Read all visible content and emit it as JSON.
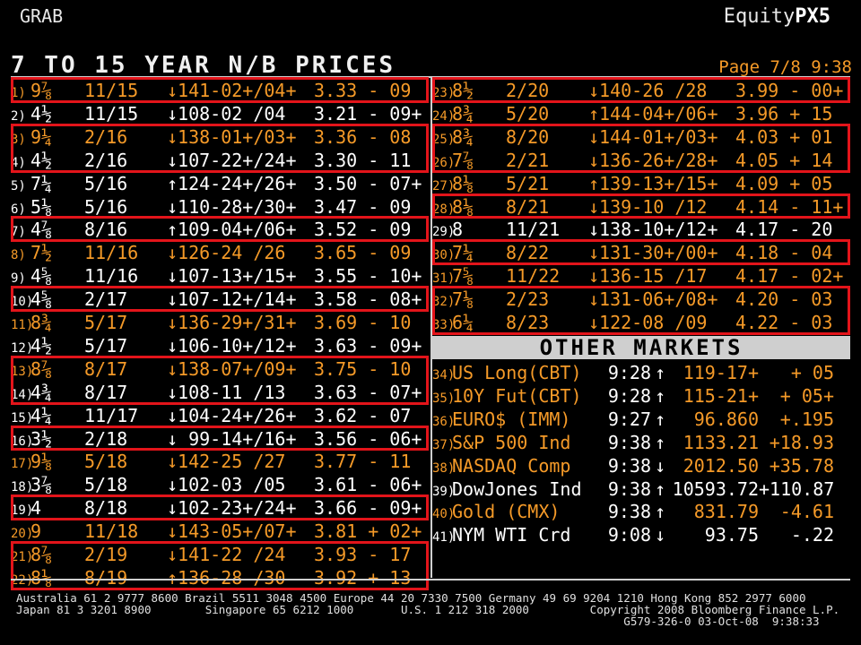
{
  "header": {
    "left": "GRAB",
    "brand_plain": "Equity",
    "brand_bold": "PX5"
  },
  "title": "7 TO 15 YEAR N/B PRICES",
  "page_info": "Page 7/8   9:38",
  "left_rows": [
    {
      "n": "1)",
      "cpn": "9⅞",
      "mat": "11/15",
      "px": "↓141-02+/04+",
      "yld": "3.33 - 09",
      "color": "orange"
    },
    {
      "n": "2)",
      "cpn": "4½",
      "mat": "11/15",
      "px": "↓108-02 /04",
      "yld": "3.21 - 09+",
      "color": "white"
    },
    {
      "n": "3)",
      "cpn": "9¼",
      "mat": "2/16",
      "px": "↓138-01+/03+",
      "yld": "3.36 - 08",
      "color": "orange"
    },
    {
      "n": "4)",
      "cpn": "4½",
      "mat": "2/16",
      "px": "↓107-22+/24+",
      "yld": "3.30 - 11",
      "color": "white"
    },
    {
      "n": "5)",
      "cpn": "7¼",
      "mat": "5/16",
      "px": "↑124-24+/26+",
      "yld": "3.50 - 07+",
      "color": "white"
    },
    {
      "n": "6)",
      "cpn": "5⅛",
      "mat": "5/16",
      "px": "↓110-28+/30+",
      "yld": "3.47 - 09",
      "color": "white"
    },
    {
      "n": "7)",
      "cpn": "4⅞",
      "mat": "8/16",
      "px": "↑109-04+/06+",
      "yld": "3.52 - 09",
      "color": "white"
    },
    {
      "n": "8)",
      "cpn": "7½",
      "mat": "11/16",
      "px": "↓126-24 /26",
      "yld": "3.65 - 09",
      "color": "orange"
    },
    {
      "n": "9)",
      "cpn": "4⅝",
      "mat": "11/16",
      "px": "↓107-13+/15+",
      "yld": "3.55 - 10+",
      "color": "white"
    },
    {
      "n": "10)",
      "cpn": "4⅝",
      "mat": "2/17",
      "px": "↓107-12+/14+",
      "yld": "3.58 - 08+",
      "color": "white"
    },
    {
      "n": "11)",
      "cpn": "8¾",
      "mat": "5/17",
      "px": "↓136-29+/31+",
      "yld": "3.69 - 10",
      "color": "orange"
    },
    {
      "n": "12)",
      "cpn": "4½",
      "mat": "5/17",
      "px": "↓106-10+/12+",
      "yld": "3.63 - 09+",
      "color": "white"
    },
    {
      "n": "13)",
      "cpn": "8⅞",
      "mat": "8/17",
      "px": "↓138-07+/09+",
      "yld": "3.75 - 10",
      "color": "orange"
    },
    {
      "n": "14)",
      "cpn": "4¾",
      "mat": "8/17",
      "px": "↓108-11 /13",
      "yld": "3.63 - 07+",
      "color": "white"
    },
    {
      "n": "15)",
      "cpn": "4¼",
      "mat": "11/17",
      "px": "↓104-24+/26+",
      "yld": "3.62 - 07",
      "color": "white"
    },
    {
      "n": "16)",
      "cpn": "3½",
      "mat": "2/18",
      "px": "↓ 99-14+/16+",
      "yld": "3.56 - 06+",
      "color": "white"
    },
    {
      "n": "17)",
      "cpn": "9⅛",
      "mat": "5/18",
      "px": "↓142-25 /27",
      "yld": "3.77 - 11",
      "color": "orange"
    },
    {
      "n": "18)",
      "cpn": "3⅞",
      "mat": "5/18",
      "px": "↓102-03 /05",
      "yld": "3.61 - 06+",
      "color": "white"
    },
    {
      "n": "19)",
      "cpn": "4",
      "mat": "8/18",
      "px": "↓102-23+/24+",
      "yld": "3.66 - 09+",
      "color": "white"
    },
    {
      "n": "20)",
      "cpn": "9",
      "mat": "11/18",
      "px": "↓143-05+/07+",
      "yld": "3.81 + 02+",
      "color": "orange"
    },
    {
      "n": "21)",
      "cpn": "8⅞",
      "mat": "2/19",
      "px": "↓141-22 /24",
      "yld": "3.93 - 17",
      "color": "orange"
    },
    {
      "n": "22)",
      "cpn": "8⅛",
      "mat": "8/19",
      "px": "↑136-28 /30",
      "yld": "3.92 + 13",
      "color": "orange"
    }
  ],
  "right_rows": [
    {
      "n": "23)",
      "cpn": "8½",
      "mat": "2/20",
      "px": "↓140-26 /28",
      "yld": "3.99 - 00+",
      "color": "orange"
    },
    {
      "n": "24)",
      "cpn": "8¾",
      "mat": "5/20",
      "px": "↑144-04+/06+",
      "yld": "3.96 + 15",
      "color": "orange"
    },
    {
      "n": "25)",
      "cpn": "8¾",
      "mat": "8/20",
      "px": "↓144-01+/03+",
      "yld": "4.03 + 01",
      "color": "orange"
    },
    {
      "n": "26)",
      "cpn": "7⅞",
      "mat": "2/21",
      "px": "↓136-26+/28+",
      "yld": "4.05 + 14",
      "color": "orange"
    },
    {
      "n": "27)",
      "cpn": "8⅛",
      "mat": "5/21",
      "px": "↑139-13+/15+",
      "yld": "4.09 + 05",
      "color": "orange"
    },
    {
      "n": "28)",
      "cpn": "8⅛",
      "mat": "8/21",
      "px": "↓139-10 /12",
      "yld": "4.14 - 11+",
      "color": "orange"
    },
    {
      "n": "29)",
      "cpn": "8",
      "mat": "11/21",
      "px": "↓138-10+/12+",
      "yld": "4.17 - 20",
      "color": "white"
    },
    {
      "n": "30)",
      "cpn": "7¼",
      "mat": "8/22",
      "px": "↓131-30+/00+",
      "yld": "4.18 - 04",
      "color": "orange"
    },
    {
      "n": "31)",
      "cpn": "7⅝",
      "mat": "11/22",
      "px": "↓136-15 /17",
      "yld": "4.17 - 02+",
      "color": "orange"
    },
    {
      "n": "32)",
      "cpn": "7⅛",
      "mat": "2/23",
      "px": "↓131-06+/08+",
      "yld": "4.20 - 03",
      "color": "orange"
    },
    {
      "n": "33)",
      "cpn": "6¼",
      "mat": "8/23",
      "px": "↓122-08 /09",
      "yld": "4.22 - 03",
      "color": "orange"
    }
  ],
  "other_markets": {
    "title": "OTHER MARKETS",
    "rows": [
      {
        "n": "34)",
        "name": "US Long(CBT)",
        "time": "9:28",
        "arrow": "↑",
        "price": "119-17+",
        "chg": "+ 05",
        "color": "orange"
      },
      {
        "n": "35)",
        "name": "10Y Fut(CBT)",
        "time": "9:28",
        "arrow": "↑",
        "price": "115-21+",
        "chg": "+ 05+",
        "color": "orange"
      },
      {
        "n": "36)",
        "name": "EURO$ (IMM)",
        "time": "9:27",
        "arrow": "↑",
        "price": "96.860",
        "chg": "+.195",
        "color": "orange"
      },
      {
        "n": "37)",
        "name": "S&P 500 Ind",
        "time": "9:38",
        "arrow": "↑",
        "price": "1133.21",
        "chg": "+18.93",
        "color": "orange"
      },
      {
        "n": "38)",
        "name": "NASDAQ Comp",
        "time": "9:38",
        "arrow": "↓",
        "price": "2012.50",
        "chg": "+35.78",
        "color": "orange"
      },
      {
        "n": "39)",
        "name": "DowJones Ind",
        "time": "9:38",
        "arrow": "↑",
        "price": "10593.72",
        "chg": "+110.87",
        "color": "white"
      },
      {
        "n": "40)",
        "name": "Gold (CMX)",
        "time": "9:38",
        "arrow": "↑",
        "price": "831.79",
        "chg": "-4.61",
        "color": "orange"
      },
      {
        "n": "41)",
        "name": "NYM WTI Crd",
        "time": "9:08",
        "arrow": "↓",
        "price": "93.75",
        "chg": "-.22",
        "color": "white"
      }
    ]
  },
  "footer": {
    "line1": "Australia 61 2 9777 8600 Brazil 5511 3048 4500 Europe 44 20 7330 7500 Germany 49 69 9204 1210 Hong Kong 852 2977 6000",
    "line2": "Japan 81 3 3201 8900        Singapore 65 6212 1000       U.S. 1 212 318 2000         Copyright 2008 Bloomberg Finance L.P.",
    "line3": "                                                                                          G579-326-0 03-Oct-08  9:38:33"
  },
  "colors": {
    "orange": "#f59a28",
    "white": "#ffffff",
    "highlight": "#e3141a",
    "bar": "#cfcfcf"
  }
}
